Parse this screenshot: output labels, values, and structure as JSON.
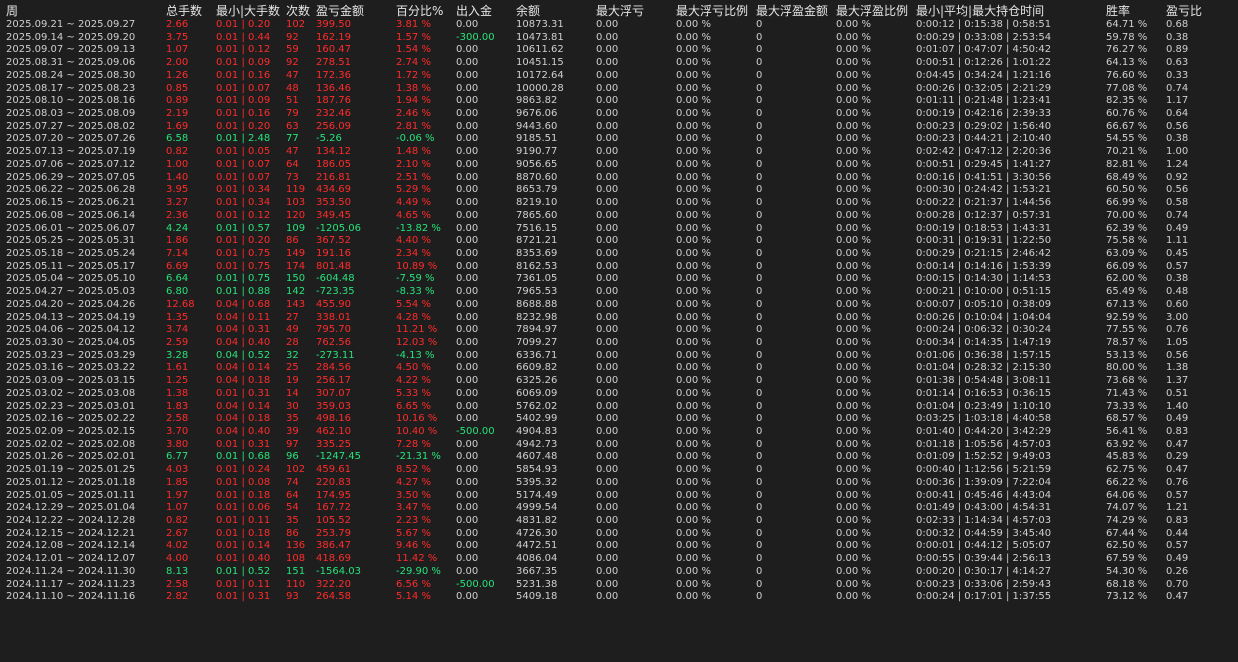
{
  "columns": [
    "周",
    "总手数",
    "最小|大手数",
    "次数",
    "盈亏金额",
    "百分比%",
    "出入金",
    "余额",
    "最大浮亏",
    "最大浮亏比例",
    "最大浮盈金额",
    "最大浮盈比例",
    "最小|平均|最大持仓时间",
    "胜率",
    "盈亏比"
  ],
  "colors": {
    "background": "#1e1e1e",
    "text": "#cfcfcf",
    "profit": "#ff2b2b",
    "loss": "#27e27a"
  },
  "rows": [
    {
      "cells": [
        "2025.09.21 ~ 2025.09.27",
        "2.66",
        "0.01 | 0.20",
        "102",
        "399.50",
        "3.81 %",
        "0.00",
        "10873.31",
        "0.00",
        "0.00 %",
        "0",
        "0.00 %",
        "0:00:12 | 0:15:38 | 0:58:51",
        "64.71 %",
        "0.68"
      ],
      "tone": "pos"
    },
    {
      "cells": [
        "2025.09.14 ~ 2025.09.20",
        "3.75",
        "0.01 | 0.44",
        "92",
        "162.19",
        "1.57 %",
        "-300.00",
        "10473.81",
        "0.00",
        "0.00 %",
        "0",
        "0.00 %",
        "0:00:29 | 0:33:08 | 2:53:54",
        "59.78 %",
        "0.38"
      ],
      "tone": "pos",
      "flow": "neg"
    },
    {
      "cells": [
        "2025.09.07 ~ 2025.09.13",
        "1.07",
        "0.01 | 0.12",
        "59",
        "160.47",
        "1.54 %",
        "0.00",
        "10611.62",
        "0.00",
        "0.00 %",
        "0",
        "0.00 %",
        "0:01:07 | 0:47:07 | 4:50:42",
        "76.27 %",
        "0.89"
      ],
      "tone": "pos"
    },
    {
      "cells": [
        "2025.08.31 ~ 2025.09.06",
        "2.00",
        "0.01 | 0.09",
        "92",
        "278.51",
        "2.74 %",
        "0.00",
        "10451.15",
        "0.00",
        "0.00 %",
        "0",
        "0.00 %",
        "0:00:51 | 0:12:26 | 1:01:22",
        "64.13 %",
        "0.63"
      ],
      "tone": "pos"
    },
    {
      "cells": [
        "2025.08.24 ~ 2025.08.30",
        "1.26",
        "0.01 | 0.16",
        "47",
        "172.36",
        "1.72 %",
        "0.00",
        "10172.64",
        "0.00",
        "0.00 %",
        "0",
        "0.00 %",
        "0:04:45 | 0:34:24 | 1:21:16",
        "76.60 %",
        "0.33"
      ],
      "tone": "pos"
    },
    {
      "cells": [
        "2025.08.17 ~ 2025.08.23",
        "0.85",
        "0.01 | 0.07",
        "48",
        "136.46",
        "1.38 %",
        "0.00",
        "10000.28",
        "0.00",
        "0.00 %",
        "0",
        "0.00 %",
        "0:00:26 | 0:32:05 | 2:21:29",
        "77.08 %",
        "0.74"
      ],
      "tone": "pos"
    },
    {
      "cells": [
        "2025.08.10 ~ 2025.08.16",
        "0.89",
        "0.01 | 0.09",
        "51",
        "187.76",
        "1.94 %",
        "0.00",
        "9863.82",
        "0.00",
        "0.00 %",
        "0",
        "0.00 %",
        "0:01:11 | 0:21:48 | 1:23:41",
        "82.35 %",
        "1.17"
      ],
      "tone": "pos"
    },
    {
      "cells": [
        "2025.08.03 ~ 2025.08.09",
        "2.19",
        "0.01 | 0.16",
        "79",
        "232.46",
        "2.46 %",
        "0.00",
        "9676.06",
        "0.00",
        "0.00 %",
        "0",
        "0.00 %",
        "0:00:19 | 0:42:16 | 2:39:33",
        "60.76 %",
        "0.64"
      ],
      "tone": "pos"
    },
    {
      "cells": [
        "2025.07.27 ~ 2025.08.02",
        "1.69",
        "0.01 | 0.20",
        "63",
        "256.09",
        "2.81 %",
        "0.00",
        "9443.60",
        "0.00",
        "0.00 %",
        "0",
        "0.00 %",
        "0:00:23 | 0:29:02 | 1:56:40",
        "66.67 %",
        "0.56"
      ],
      "tone": "pos"
    },
    {
      "cells": [
        "2025.07.20 ~ 2025.07.26",
        "6.58",
        "0.01 | 2.48",
        "77",
        "-5.26",
        "-0.06 %",
        "0.00",
        "9185.51",
        "0.00",
        "0.00 %",
        "0",
        "0.00 %",
        "0:00:23 | 0:44:21 | 2:10:40",
        "54.55 %",
        "0.38"
      ],
      "tone": "neg"
    },
    {
      "cells": [
        "2025.07.13 ~ 2025.07.19",
        "0.82",
        "0.01 | 0.05",
        "47",
        "134.12",
        "1.48 %",
        "0.00",
        "9190.77",
        "0.00",
        "0.00 %",
        "0",
        "0.00 %",
        "0:02:42 | 0:47:12 | 2:20:36",
        "70.21 %",
        "1.00"
      ],
      "tone": "pos"
    },
    {
      "cells": [
        "2025.07.06 ~ 2025.07.12",
        "1.00",
        "0.01 | 0.07",
        "64",
        "186.05",
        "2.10 %",
        "0.00",
        "9056.65",
        "0.00",
        "0.00 %",
        "0",
        "0.00 %",
        "0:00:51 | 0:29:45 | 1:41:27",
        "82.81 %",
        "1.24"
      ],
      "tone": "pos"
    },
    {
      "cells": [
        "2025.06.29 ~ 2025.07.05",
        "1.40",
        "0.01 | 0.07",
        "73",
        "216.81",
        "2.51 %",
        "0.00",
        "8870.60",
        "0.00",
        "0.00 %",
        "0",
        "0.00 %",
        "0:00:16 | 0:41:51 | 3:30:56",
        "68.49 %",
        "0.92"
      ],
      "tone": "pos"
    },
    {
      "cells": [
        "2025.06.22 ~ 2025.06.28",
        "3.95",
        "0.01 | 0.34",
        "119",
        "434.69",
        "5.29 %",
        "0.00",
        "8653.79",
        "0.00",
        "0.00 %",
        "0",
        "0.00 %",
        "0:00:30 | 0:24:42 | 1:53:21",
        "60.50 %",
        "0.56"
      ],
      "tone": "pos"
    },
    {
      "cells": [
        "2025.06.15 ~ 2025.06.21",
        "3.27",
        "0.01 | 0.34",
        "103",
        "353.50",
        "4.49 %",
        "0.00",
        "8219.10",
        "0.00",
        "0.00 %",
        "0",
        "0.00 %",
        "0:00:22 | 0:21:37 | 1:44:56",
        "66.99 %",
        "0.58"
      ],
      "tone": "pos"
    },
    {
      "cells": [
        "2025.06.08 ~ 2025.06.14",
        "2.36",
        "0.01 | 0.12",
        "120",
        "349.45",
        "4.65 %",
        "0.00",
        "7865.60",
        "0.00",
        "0.00 %",
        "0",
        "0.00 %",
        "0:00:28 | 0:12:37 | 0:57:31",
        "70.00 %",
        "0.74"
      ],
      "tone": "pos"
    },
    {
      "cells": [
        "2025.06.01 ~ 2025.06.07",
        "4.24",
        "0.01 | 0.57",
        "109",
        "-1205.06",
        "-13.82 %",
        "0.00",
        "7516.15",
        "0.00",
        "0.00 %",
        "0",
        "0.00 %",
        "0:00:19 | 0:18:53 | 1:43:31",
        "62.39 %",
        "0.49"
      ],
      "tone": "neg"
    },
    {
      "cells": [
        "2025.05.25 ~ 2025.05.31",
        "1.86",
        "0.01 | 0.20",
        "86",
        "367.52",
        "4.40 %",
        "0.00",
        "8721.21",
        "0.00",
        "0.00 %",
        "0",
        "0.00 %",
        "0:00:31 | 0:19:31 | 1:22:50",
        "75.58 %",
        "1.11"
      ],
      "tone": "pos"
    },
    {
      "cells": [
        "2025.05.18 ~ 2025.05.24",
        "7.14",
        "0.01 | 0.75",
        "149",
        "191.16",
        "2.34 %",
        "0.00",
        "8353.69",
        "0.00",
        "0.00 %",
        "0",
        "0.00 %",
        "0:00:29 | 0:21:15 | 2:46:42",
        "63.09 %",
        "0.45"
      ],
      "tone": "pos"
    },
    {
      "cells": [
        "2025.05.11 ~ 2025.05.17",
        "6.69",
        "0.01 | 0.75",
        "174",
        "801.48",
        "10.89 %",
        "0.00",
        "8162.53",
        "0.00",
        "0.00 %",
        "0",
        "0.00 %",
        "0:00:14 | 0:14:16 | 1:53:39",
        "66.09 %",
        "0.57"
      ],
      "tone": "pos"
    },
    {
      "cells": [
        "2025.05.04 ~ 2025.05.10",
        "6.64",
        "0.01 | 0.75",
        "150",
        "-604.48",
        "-7.59 %",
        "0.00",
        "7361.05",
        "0.00",
        "0.00 %",
        "0",
        "0.00 %",
        "0:00:15 | 0:14:30 | 1:14:53",
        "62.00 %",
        "0.38"
      ],
      "tone": "neg"
    },
    {
      "cells": [
        "2025.04.27 ~ 2025.05.03",
        "6.80",
        "0.01 | 0.88",
        "142",
        "-723.35",
        "-8.33 %",
        "0.00",
        "7965.53",
        "0.00",
        "0.00 %",
        "0",
        "0.00 %",
        "0:00:21 | 0:10:00 | 0:51:15",
        "65.49 %",
        "0.48"
      ],
      "tone": "neg"
    },
    {
      "cells": [
        "2025.04.20 ~ 2025.04.26",
        "12.68",
        "0.04 | 0.68",
        "143",
        "455.90",
        "5.54 %",
        "0.00",
        "8688.88",
        "0.00",
        "0.00 %",
        "0",
        "0.00 %",
        "0:00:07 | 0:05:10 | 0:38:09",
        "67.13 %",
        "0.60"
      ],
      "tone": "pos"
    },
    {
      "cells": [
        "2025.04.13 ~ 2025.04.19",
        "1.35",
        "0.04 | 0.11",
        "27",
        "338.01",
        "4.28 %",
        "0.00",
        "8232.98",
        "0.00",
        "0.00 %",
        "0",
        "0.00 %",
        "0:00:26 | 0:10:04 | 1:04:04",
        "92.59 %",
        "3.00"
      ],
      "tone": "pos"
    },
    {
      "cells": [
        "2025.04.06 ~ 2025.04.12",
        "3.74",
        "0.04 | 0.31",
        "49",
        "795.70",
        "11.21 %",
        "0.00",
        "7894.97",
        "0.00",
        "0.00 %",
        "0",
        "0.00 %",
        "0:00:24 | 0:06:32 | 0:30:24",
        "77.55 %",
        "0.76"
      ],
      "tone": "pos"
    },
    {
      "cells": [
        "2025.03.30 ~ 2025.04.05",
        "2.59",
        "0.04 | 0.40",
        "28",
        "762.56",
        "12.03 %",
        "0.00",
        "7099.27",
        "0.00",
        "0.00 %",
        "0",
        "0.00 %",
        "0:00:34 | 0:14:35 | 1:47:19",
        "78.57 %",
        "1.05"
      ],
      "tone": "pos"
    },
    {
      "cells": [
        "2025.03.23 ~ 2025.03.29",
        "3.28",
        "0.04 | 0.52",
        "32",
        "-273.11",
        "-4.13 %",
        "0.00",
        "6336.71",
        "0.00",
        "0.00 %",
        "0",
        "0.00 %",
        "0:01:06 | 0:36:38 | 1:57:15",
        "53.13 %",
        "0.56"
      ],
      "tone": "neg"
    },
    {
      "cells": [
        "2025.03.16 ~ 2025.03.22",
        "1.61",
        "0.04 | 0.14",
        "25",
        "284.56",
        "4.50 %",
        "0.00",
        "6609.82",
        "0.00",
        "0.00 %",
        "0",
        "0.00 %",
        "0:01:04 | 0:28:32 | 2:15:30",
        "80.00 %",
        "1.38"
      ],
      "tone": "pos"
    },
    {
      "cells": [
        "2025.03.09 ~ 2025.03.15",
        "1.25",
        "0.04 | 0.18",
        "19",
        "256.17",
        "4.22 %",
        "0.00",
        "6325.26",
        "0.00",
        "0.00 %",
        "0",
        "0.00 %",
        "0:01:38 | 0:54:48 | 3:08:11",
        "73.68 %",
        "1.37"
      ],
      "tone": "pos"
    },
    {
      "cells": [
        "2025.03.02 ~ 2025.03.08",
        "1.38",
        "0.01 | 0.31",
        "14",
        "307.07",
        "5.33 %",
        "0.00",
        "6069.09",
        "0.00",
        "0.00 %",
        "0",
        "0.00 %",
        "0:01:14 | 0:16:53 | 0:36:15",
        "71.43 %",
        "0.51"
      ],
      "tone": "pos"
    },
    {
      "cells": [
        "2025.02.23 ~ 2025.03.01",
        "1.83",
        "0.04 | 0.14",
        "30",
        "359.03",
        "6.65 %",
        "0.00",
        "5762.02",
        "0.00",
        "0.00 %",
        "0",
        "0.00 %",
        "0:01:04 | 0:23:49 | 1:10:10",
        "73.33 %",
        "1.40"
      ],
      "tone": "pos"
    },
    {
      "cells": [
        "2025.02.16 ~ 2025.02.22",
        "2.58",
        "0.04 | 0.18",
        "35",
        "498.16",
        "10.16 %",
        "0.00",
        "5402.99",
        "0.00",
        "0.00 %",
        "0",
        "0.00 %",
        "0:03:25 | 1:03:18 | 4:40:58",
        "68.57 %",
        "0.49"
      ],
      "tone": "pos"
    },
    {
      "cells": [
        "2025.02.09 ~ 2025.02.15",
        "3.70",
        "0.04 | 0.40",
        "39",
        "462.10",
        "10.40 %",
        "-500.00",
        "4904.83",
        "0.00",
        "0.00 %",
        "0",
        "0.00 %",
        "0:01:40 | 0:44:20 | 3:42:29",
        "56.41 %",
        "0.83"
      ],
      "tone": "pos",
      "flow": "neg"
    },
    {
      "cells": [
        "2025.02.02 ~ 2025.02.08",
        "3.80",
        "0.01 | 0.31",
        "97",
        "335.25",
        "7.28 %",
        "0.00",
        "4942.73",
        "0.00",
        "0.00 %",
        "0",
        "0.00 %",
        "0:01:18 | 1:05:56 | 4:57:03",
        "63.92 %",
        "0.47"
      ],
      "tone": "pos"
    },
    {
      "cells": [
        "2025.01.26 ~ 2025.02.01",
        "6.77",
        "0.01 | 0.68",
        "96",
        "-1247.45",
        "-21.31 %",
        "0.00",
        "4607.48",
        "0.00",
        "0.00 %",
        "0",
        "0.00 %",
        "0:01:09 | 1:52:52 | 9:49:03",
        "45.83 %",
        "0.29"
      ],
      "tone": "neg"
    },
    {
      "cells": [
        "2025.01.19 ~ 2025.01.25",
        "4.03",
        "0.01 | 0.24",
        "102",
        "459.61",
        "8.52 %",
        "0.00",
        "5854.93",
        "0.00",
        "0.00 %",
        "0",
        "0.00 %",
        "0:00:40 | 1:12:56 | 5:21:59",
        "62.75 %",
        "0.47"
      ],
      "tone": "pos"
    },
    {
      "cells": [
        "2025.01.12 ~ 2025.01.18",
        "1.85",
        "0.01 | 0.08",
        "74",
        "220.83",
        "4.27 %",
        "0.00",
        "5395.32",
        "0.00",
        "0.00 %",
        "0",
        "0.00 %",
        "0:00:36 | 1:39:09 | 7:22:04",
        "66.22 %",
        "0.76"
      ],
      "tone": "pos"
    },
    {
      "cells": [
        "2025.01.05 ~ 2025.01.11",
        "1.97",
        "0.01 | 0.18",
        "64",
        "174.95",
        "3.50 %",
        "0.00",
        "5174.49",
        "0.00",
        "0.00 %",
        "0",
        "0.00 %",
        "0:00:41 | 0:45:46 | 4:43:04",
        "64.06 %",
        "0.57"
      ],
      "tone": "pos"
    },
    {
      "cells": [
        "2024.12.29 ~ 2025.01.04",
        "1.07",
        "0.01 | 0.06",
        "54",
        "167.72",
        "3.47 %",
        "0.00",
        "4999.54",
        "0.00",
        "0.00 %",
        "0",
        "0.00 %",
        "0:01:49 | 0:43:00 | 4:54:31",
        "74.07 %",
        "1.21"
      ],
      "tone": "pos"
    },
    {
      "cells": [
        "2024.12.22 ~ 2024.12.28",
        "0.82",
        "0.01 | 0.11",
        "35",
        "105.52",
        "2.23 %",
        "0.00",
        "4831.82",
        "0.00",
        "0.00 %",
        "0",
        "0.00 %",
        "0:02:33 | 1:14:34 | 4:57:03",
        "74.29 %",
        "0.83"
      ],
      "tone": "pos"
    },
    {
      "cells": [
        "2024.12.15 ~ 2024.12.21",
        "2.67",
        "0.01 | 0.18",
        "86",
        "253.79",
        "5.67 %",
        "0.00",
        "4726.30",
        "0.00",
        "0.00 %",
        "0",
        "0.00 %",
        "0:00:32 | 0:44:59 | 3:45:40",
        "67.44 %",
        "0.44"
      ],
      "tone": "pos"
    },
    {
      "cells": [
        "2024.12.08 ~ 2024.12.14",
        "4.02",
        "0.01 | 0.14",
        "136",
        "386.47",
        "9.46 %",
        "0.00",
        "4472.51",
        "0.00",
        "0.00 %",
        "0",
        "0.00 %",
        "0:00:01 | 0:44:12 | 5:05:07",
        "62.50 %",
        "0.57"
      ],
      "tone": "pos"
    },
    {
      "cells": [
        "2024.12.01 ~ 2024.12.07",
        "4.00",
        "0.01 | 0.40",
        "108",
        "418.69",
        "11.42 %",
        "0.00",
        "4086.04",
        "0.00",
        "0.00 %",
        "0",
        "0.00 %",
        "0:00:55 | 0:39:44 | 2:56:13",
        "67.59 %",
        "0.49"
      ],
      "tone": "pos"
    },
    {
      "cells": [
        "2024.11.24 ~ 2024.11.30",
        "8.13",
        "0.01 | 0.52",
        "151",
        "-1564.03",
        "-29.90 %",
        "0.00",
        "3667.35",
        "0.00",
        "0.00 %",
        "0",
        "0.00 %",
        "0:00:20 | 0:30:17 | 4:14:27",
        "54.30 %",
        "0.26"
      ],
      "tone": "neg"
    },
    {
      "cells": [
        "2024.11.17 ~ 2024.11.23",
        "2.58",
        "0.01 | 0.11",
        "110",
        "322.20",
        "6.56 %",
        "-500.00",
        "5231.38",
        "0.00",
        "0.00 %",
        "0",
        "0.00 %",
        "0:00:23 | 0:33:06 | 2:59:43",
        "68.18 %",
        "0.70"
      ],
      "tone": "pos",
      "flow": "neg"
    },
    {
      "cells": [
        "2024.11.10 ~ 2024.11.16",
        "2.82",
        "0.01 | 0.31",
        "93",
        "264.58",
        "5.14 %",
        "0.00",
        "5409.18",
        "0.00",
        "0.00 %",
        "0",
        "0.00 %",
        "0:00:24 | 0:17:01 | 1:37:55",
        "73.12 %",
        "0.47"
      ],
      "tone": "pos"
    }
  ]
}
